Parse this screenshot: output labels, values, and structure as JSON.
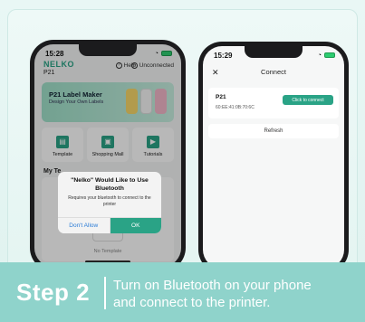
{
  "left_phone": {
    "time": "15:28",
    "brand": "NELKO",
    "model": "P21",
    "help_label": "Help",
    "connection_label": "Unconnected",
    "banner": {
      "title": "P21 Label Maker",
      "subtitle": "Design Your Own Labels"
    },
    "tiles": [
      {
        "label": "Template",
        "icon": "template-icon"
      },
      {
        "label": "Shopping Mall",
        "icon": "shopping-icon"
      },
      {
        "label": "Tutorials",
        "icon": "play-icon"
      }
    ],
    "section_title": "My Te",
    "empty_text": "No Template",
    "dialog": {
      "title": "\"Nelko\" Would Like to Use Bluetooth",
      "message": "Requires your bluetooth to connect to the printer",
      "deny_label": "Don't Allow",
      "ok_label": "OK"
    }
  },
  "right_phone": {
    "time": "15:29",
    "title": "Connect",
    "device": {
      "name": "P21",
      "mac": "60:EE:41:0B:70:6C",
      "connect_label": "Click to connect"
    },
    "refresh_label": "Refresh"
  },
  "caption": {
    "step": "Step 2",
    "line1": "Turn on Bluetooth on your phone",
    "line2": "and connect to the printer."
  },
  "colors": {
    "accent": "#2aa386",
    "caption_bg": "#8fd3cb"
  }
}
